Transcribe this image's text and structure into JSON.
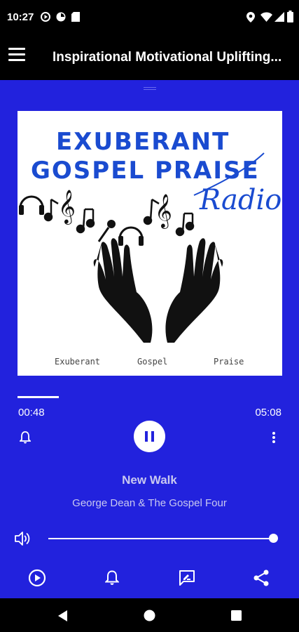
{
  "status_bar": {
    "time": "10:27"
  },
  "app_bar": {
    "title": "Inspirational Motivational Uplifting..."
  },
  "artwork": {
    "line1": "EXUBERANT",
    "line2": "GOSPEL PRAISE",
    "radio": "Radio",
    "captions": [
      "Exuberant",
      "Gospel",
      "Praise"
    ]
  },
  "player": {
    "elapsed": "00:48",
    "duration": "05:08",
    "progress_fraction": 0.156,
    "volume_fraction": 1.0,
    "state": "playing"
  },
  "track": {
    "title": "New Walk",
    "artist": "George Dean & The Gospel Four"
  },
  "colors": {
    "background": "#2222DD",
    "accent": "#FFFFFF",
    "logo_blue": "#1A4BD0"
  },
  "icons": {
    "status": [
      "play-circle-icon",
      "data-saver-icon",
      "sd-card-icon",
      "location-icon",
      "wifi-icon",
      "signal-icon",
      "battery-icon"
    ],
    "bottom_actions": [
      "play-circle-icon",
      "bell-icon",
      "message-icon",
      "share-icon"
    ],
    "nav": [
      "back-icon",
      "home-icon",
      "recents-icon"
    ]
  }
}
